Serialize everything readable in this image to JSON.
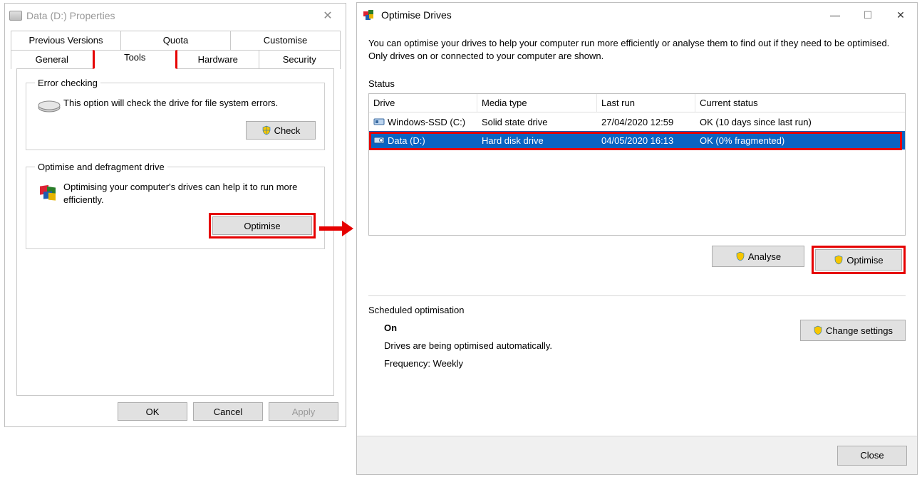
{
  "props": {
    "title": "Data (D:) Properties",
    "tabs_row1": [
      "Previous Versions",
      "Quota",
      "Customise"
    ],
    "tabs_row2": [
      "General",
      "Tools",
      "Hardware",
      "Security"
    ],
    "active_tab": "Tools",
    "error_check": {
      "legend": "Error checking",
      "text": "This option will check the drive for file system errors.",
      "button": "Check"
    },
    "optimise": {
      "legend": "Optimise and defragment drive",
      "text": "Optimising your computer's drives can help it to run more efficiently.",
      "button": "Optimise"
    },
    "buttons": {
      "ok": "OK",
      "cancel": "Cancel",
      "apply": "Apply"
    }
  },
  "opt": {
    "title": "Optimise Drives",
    "intro": "You can optimise your drives to help your computer run more efficiently or analyse them to find out if they need to be optimised. Only drives on or connected to your computer are shown.",
    "status_label": "Status",
    "columns": {
      "drive": "Drive",
      "media": "Media type",
      "last": "Last run",
      "status": "Current status"
    },
    "rows": [
      {
        "drive": "Windows-SSD (C:)",
        "media": "Solid state drive",
        "last": "27/04/2020 12:59",
        "status": "OK (10 days since last run)",
        "selected": false,
        "icon": "ssd"
      },
      {
        "drive": "Data (D:)",
        "media": "Hard disk drive",
        "last": "04/05/2020 16:13",
        "status": "OK (0% fragmented)",
        "selected": true,
        "icon": "hdd"
      }
    ],
    "analyse": "Analyse",
    "optimise": "Optimise",
    "sched_label": "Scheduled optimisation",
    "sched": {
      "on": "On",
      "desc": "Drives are being optimised automatically.",
      "freq": "Frequency: Weekly",
      "change": "Change settings"
    },
    "close": "Close"
  }
}
